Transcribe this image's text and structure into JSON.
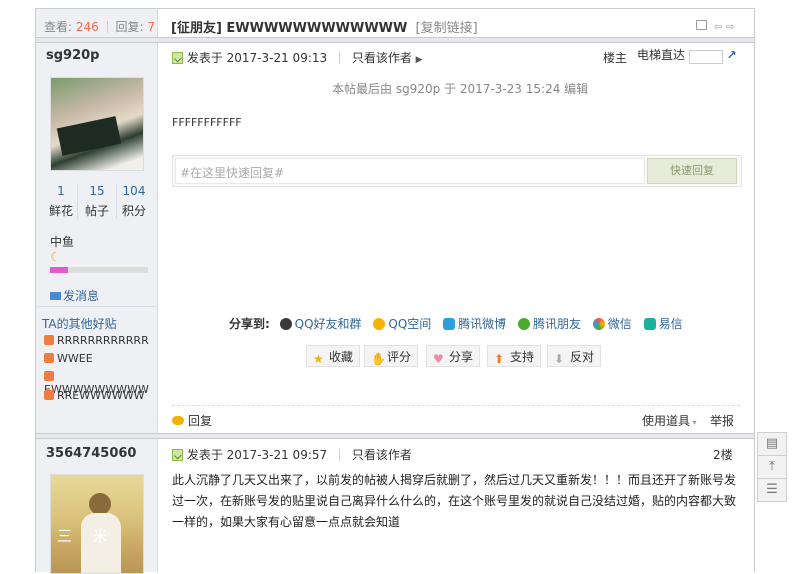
{
  "thread": {
    "views_label": "查看:",
    "views": "246",
    "replies_label": "回复:",
    "replies": "7",
    "title": "[征朋友] EWWWWWWWWWWWW",
    "copy_link": "[复制链接]"
  },
  "post1": {
    "author": "sg920p",
    "stats": [
      {
        "value": "1",
        "label": "鲜花"
      },
      {
        "value": "15",
        "label": "帖子"
      },
      {
        "value": "104",
        "label": "积分"
      }
    ],
    "rank": "中鱼",
    "message_link": "发消息",
    "fav_title": "TA的其他好贴",
    "fav_items": [
      "RRRRRRRRRRRR",
      "WWEE",
      "EWWWWWWWWW",
      "RREWWWWWW"
    ],
    "posted": "发表于 2017-3-21 09:13",
    "only_author": "只看该作者",
    "floor": "楼主",
    "elevator_label": "电梯直达",
    "edit_note": "本帖最后由 sg920p 于 2017-3-23 15:24 编辑",
    "content": "FFFFFFFFFFF",
    "reply_placeholder": "#在这里快速回复#",
    "quick_reply": "快速回复",
    "share_label": "分享到:",
    "share": [
      "QQ好友和群",
      "QQ空间",
      "腾讯微博",
      "腾讯朋友",
      "微信",
      "易信"
    ],
    "actions": [
      "收藏",
      "评分",
      "分享",
      "支持",
      "反对"
    ],
    "reply": "回复",
    "tools": "使用道具",
    "report": "举报"
  },
  "post2": {
    "author": "3564745060",
    "posted": "发表于 2017-3-21 09:57",
    "only_author": "只看该作者",
    "floor": "2楼",
    "content": "此人沉静了几天又出来了，以前发的帖被人揭穿后就删了，然后过几天又重新发！！！而且还开了新账号发过一次，在新账号发的贴里说自己离异什么什么的，在这个账号里发的就说自己没结过婚，贴的内容都大致一样的，如果大家有心留意一点点就会知道",
    "avatar_text": "三 米"
  }
}
